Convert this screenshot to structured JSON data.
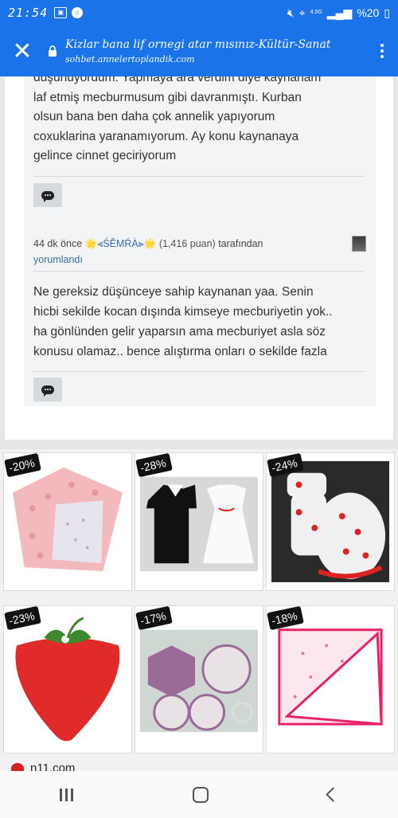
{
  "status_bar": {
    "time": "21:54",
    "network": "4.5G",
    "battery": "%20"
  },
  "topbar": {
    "title": "Kizlar bana lif ornegi atar mısınız-Kültür-Sanat",
    "url": "sohbet.annelertoplandik.com"
  },
  "comment_a": {
    "lines": [
      "düşünüyordum. Yapmaya ara verdim diye kaynanam",
      "laf etmiş mecburmusum gibi davranmıştı. Kurban",
      "olsun bana ben daha çok annelik yapıyorum",
      "coxuklarina yaranamıyorum. Ay konu kaynanaya",
      "gelince cinnet geciriyorum"
    ]
  },
  "comment_b": {
    "time_ago": "44 dk önce",
    "username": "🌟⫷ŚĔMŔÀ⫸🌟",
    "points": "(1,416 puan)",
    "by": "tarafından",
    "action": "yorumlandı",
    "lines": [
      "Ne gereksiz düşünceye sahip kaynanan yaa.  Senin",
      "hicbi sekilde kocan dışında kimseye mecburiyetin yok..",
      "ha gönlünden gelir yaparsın ama mecburiyet asla söz",
      "konusu olamaz.. bence alıştırma onları o sekilde fazla"
    ]
  },
  "ad": {
    "brand": "n11.com",
    "items": [
      {
        "discount": "-20%",
        "product": "pink-blanket"
      },
      {
        "discount": "-28%",
        "product": "tuxedo-and-dress-pot-holders"
      },
      {
        "discount": "-24%",
        "product": "gloves-and-mitt-set"
      },
      {
        "discount": "-23%",
        "product": "strawberry-pot-holder"
      },
      {
        "discount": "-17%",
        "product": "hexagon-and-circle-doilies"
      },
      {
        "discount": "-18%",
        "product": "pink-trim-towel"
      }
    ]
  },
  "colors": {
    "accent": "#1a73e8",
    "link": "#3a6fb0",
    "ad_choice": "#1a9be0"
  },
  "icons": [
    "close-icon",
    "lock-icon",
    "more-vert-icon",
    "reply-icon",
    "ad-choices-icon",
    "recents-icon",
    "home-icon",
    "back-icon"
  ]
}
